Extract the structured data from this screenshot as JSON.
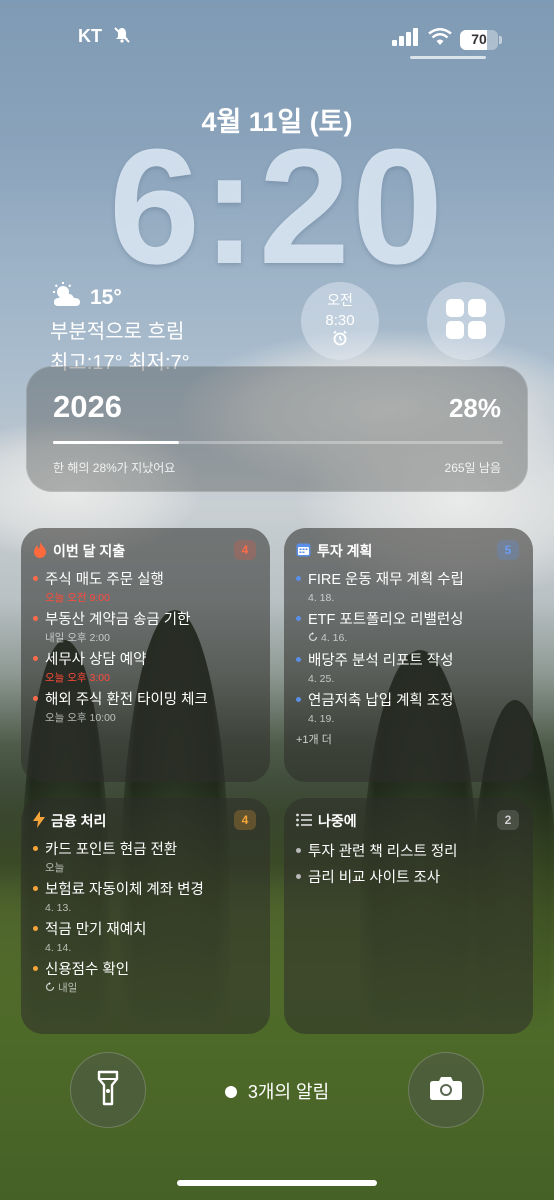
{
  "status": {
    "carrier": "KT",
    "battery": "70",
    "battery_level": 0.7
  },
  "lock": {
    "date": "4월 11일 (토)",
    "time": "6:20"
  },
  "weather": {
    "temp": "15°",
    "condition": "부분적으로 흐림",
    "hilo": "최고:17° 최저:7°",
    "icon": "partly-cloudy-icon"
  },
  "alarm": {
    "period": "오전",
    "time": "8:30",
    "icon": "alarm-clock-icon"
  },
  "year_widget": {
    "year": "2026",
    "percent": "28%",
    "progress": 0.28,
    "passed_text": "한 해의 28%가 지났어요",
    "remaining": "265일 남음"
  },
  "widgets": {
    "spending": {
      "title": "이번 달 지출",
      "count": "4",
      "accent": "#ff6a4a",
      "items": [
        {
          "text": "주식 매도 주문 실행",
          "sub": "오늘 오전 9:00"
        },
        {
          "text": "부동산 계약금 송금 기한",
          "sub": "내일 오후 2:00"
        },
        {
          "text": "세무사 상담 예약",
          "sub": "오늘 오후 3:00"
        },
        {
          "text": "해외 주식 환전 타이밍 체크",
          "sub": "오늘 오후 10:00"
        }
      ]
    },
    "invest": {
      "title": "투자 계획",
      "count": "5",
      "accent": "#5a8fe8",
      "items": [
        {
          "text": "FIRE 운동 재무 계획 수립",
          "sub": "4. 18."
        },
        {
          "text": "ETF 포트폴리오 리밸런싱",
          "sub": "4. 16."
        },
        {
          "text": "배당주 분석 리포트 작성",
          "sub": "4. 25."
        },
        {
          "text": "연금저축 납입 계획 조정",
          "sub": "4. 19."
        }
      ],
      "more": "+1개 더"
    },
    "finance": {
      "title": "금융 처리",
      "count": "4",
      "accent": "#f5a53a",
      "items": [
        {
          "text": "카드 포인트 현금 전환",
          "sub": "오늘"
        },
        {
          "text": "보험료 자동이체 계좌 변경",
          "sub": "4. 13."
        },
        {
          "text": "적금 만기 재예치",
          "sub": "4. 14."
        },
        {
          "text": "신용점수 확인",
          "sub": "내일"
        }
      ]
    },
    "later": {
      "title": "나중에",
      "count": "2",
      "accent": "#b9b9b9",
      "items": [
        {
          "text": "투자 관련 책 리스트 정리"
        },
        {
          "text": "금리 비교 사이트 조사"
        }
      ]
    }
  },
  "bottom": {
    "notifications": "3개의 알림"
  }
}
